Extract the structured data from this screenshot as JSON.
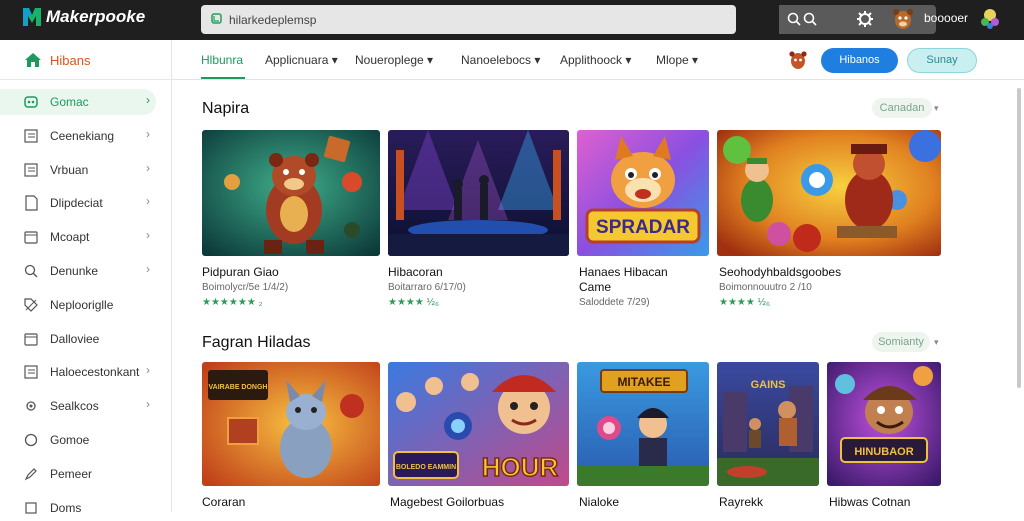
{
  "app": {
    "name": "Makerpooke"
  },
  "search": {
    "value": "hilarkedeplemsp"
  },
  "user": {
    "name": "booooer"
  },
  "sidebar": {
    "home_label": "Hibans",
    "items": [
      {
        "label": "Gomac",
        "active": true,
        "chevron": true,
        "icon": "gamepad-icon"
      },
      {
        "label": "Ceenekiang",
        "chevron": true,
        "icon": "list-icon"
      },
      {
        "label": "Vrbuan",
        "chevron": true,
        "icon": "list-icon"
      },
      {
        "label": "Dlipdeciat",
        "chevron": true,
        "icon": "document-icon"
      },
      {
        "label": "Mcoapt",
        "chevron": true,
        "icon": "box-icon"
      },
      {
        "label": "Denunke",
        "chevron": true,
        "icon": "search-icon"
      },
      {
        "label": "Neplooriglle",
        "chevron": false,
        "icon": "tag-icon"
      },
      {
        "label": "Dalloviee",
        "chevron": false,
        "icon": "box-icon"
      },
      {
        "label": "Haloecestonkant",
        "chevron": true,
        "icon": "list-icon"
      },
      {
        "label": "Sealkcos",
        "chevron": true,
        "icon": "gear-icon"
      },
      {
        "label": "Gomoe",
        "chevron": false,
        "icon": "circle-icon"
      },
      {
        "label": "Pemeer",
        "chevron": false,
        "icon": "pen-icon"
      },
      {
        "label": "Doms",
        "chevron": false,
        "icon": "square-icon"
      }
    ]
  },
  "nav": {
    "tabs": [
      {
        "label": "Hlbunra",
        "active": true
      },
      {
        "label": "Applicnuara ▾"
      },
      {
        "label": "Noueroplege ▾"
      },
      {
        "label": "Nanoelebocs ▾"
      },
      {
        "label": "Applithoock ▾"
      },
      {
        "label": "Mlope ▾"
      }
    ],
    "primary_button": "Hibanos",
    "secondary_button": "Sunay"
  },
  "sections": [
    {
      "title": "Napira",
      "pill": "Canadan",
      "cards": [
        {
          "title": "Pidpuran Giao",
          "meta": "Boimolycr/5e 1/4/2)",
          "stars": "★★★★★★ ₂"
        },
        {
          "title": "Hibacoran",
          "meta": "Boitarraro 6/17/0)",
          "stars": "★★★★ ½₆"
        },
        {
          "title": "Hanaes Hibacan\nCame",
          "meta": "Saloddete 7/29)",
          "stars": ""
        },
        {
          "title": "Seohodyhbaldsgoobes",
          "meta": "Boimonnouutro 2 /10",
          "stars": "★★★★ ½₆"
        }
      ]
    },
    {
      "title": "Fagran Hiladas",
      "pill": "Somianty",
      "cards": [
        {
          "title": "Coraran",
          "meta": "",
          "stars": ""
        },
        {
          "title": "Magebest Goilorbuas",
          "meta": "",
          "stars": ""
        },
        {
          "title": "Nialoke",
          "meta": "",
          "stars": ""
        },
        {
          "title": "Rayrekk",
          "meta": "",
          "stars": ""
        },
        {
          "title": "Hibwas Cotnan",
          "meta": "",
          "stars": ""
        }
      ]
    }
  ],
  "card_art_text": {
    "row1_card3": "SPRADAR",
    "row2_card1": "VAIRABE DONGH",
    "row2_card2": "HOUR",
    "row2_card2_badge": "BOLEDO EAMMIN",
    "row2_card3": "MITAKEE",
    "row2_card4": "GAINS",
    "row2_card5": "HINUBAOR"
  },
  "colors": {
    "accent": "#1c9b5c",
    "topbar": "#1f1f1f",
    "primary_button": "#1e7fe0",
    "home_label": "#d9561a"
  }
}
